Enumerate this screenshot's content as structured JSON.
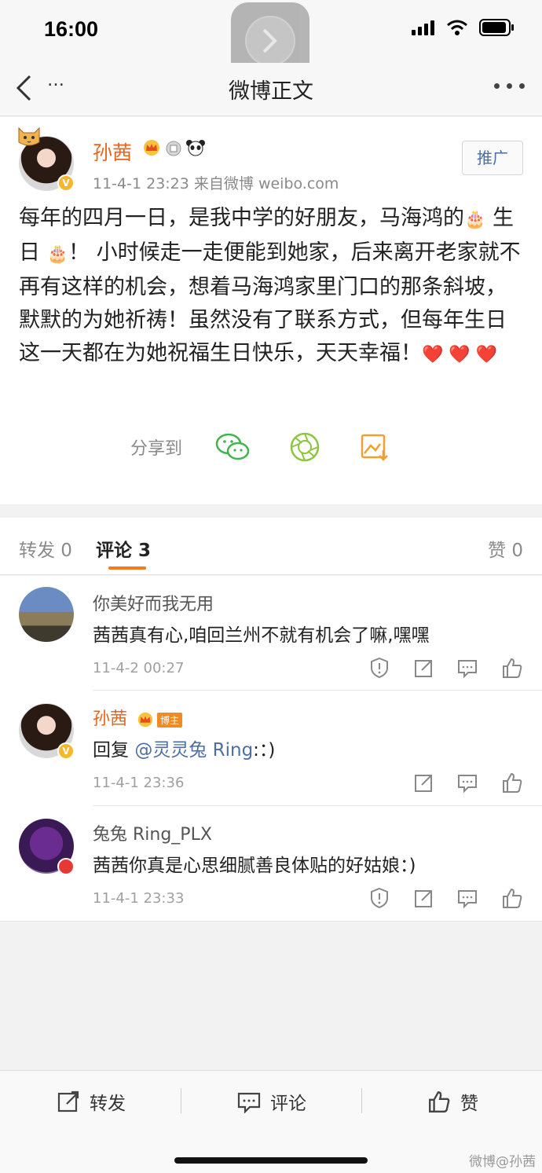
{
  "status": {
    "time": "16:00"
  },
  "nav": {
    "back_label": "…",
    "title": "微博正文"
  },
  "post": {
    "author": "孙茜",
    "meta": "11-4-1 23:23  来自微博 weibo.com",
    "promote_label": "推广",
    "text_parts": {
      "p1": "每年的四月一日，是我中学的好朋友，马海鸿的",
      "emo1": "🎂",
      "p2": " 生日 ",
      "emo2": "🎂",
      "p3": "！ 小时候走一走便能到她家，后来离开老家就不再有这样的机会，想着马海鸿家里门口的那条斜坡，默默的为她祈祷！虽然没有了联系方式，但每年生日这一天都在为她祝福生日快乐，天天幸福！",
      "hearts": "❤️ ❤️ ❤️"
    },
    "share_label": "分享到"
  },
  "tabs": {
    "repost": "转发 0",
    "comments": "评论 3",
    "likes": "赞 0"
  },
  "comments": [
    {
      "name": "你美好而我无用",
      "text": "茜茜真有心,咱回兰州不就有机会了嘛,嘿嘿",
      "time": "11-4-2 00:27"
    },
    {
      "name": "孙茜",
      "badge": "博主",
      "reply_prefix": "回复 ",
      "mention": "@灵灵兔 Ring",
      "text_suffix": ":：)",
      "time": "11-4-1 23:36"
    },
    {
      "name": "兔兔 Ring_PLX",
      "text": "茜茜你真是心思细腻善良体贴的好姑娘：)",
      "time": "11-4-1 23:33"
    }
  ],
  "bottom": {
    "repost": "转发",
    "comment": "评论",
    "like": "赞",
    "watermark": "微博@孙茜"
  },
  "colors": {
    "accent": "#f47c20",
    "name_orange": "#e8641b",
    "link_blue": "#4b6ea8"
  }
}
